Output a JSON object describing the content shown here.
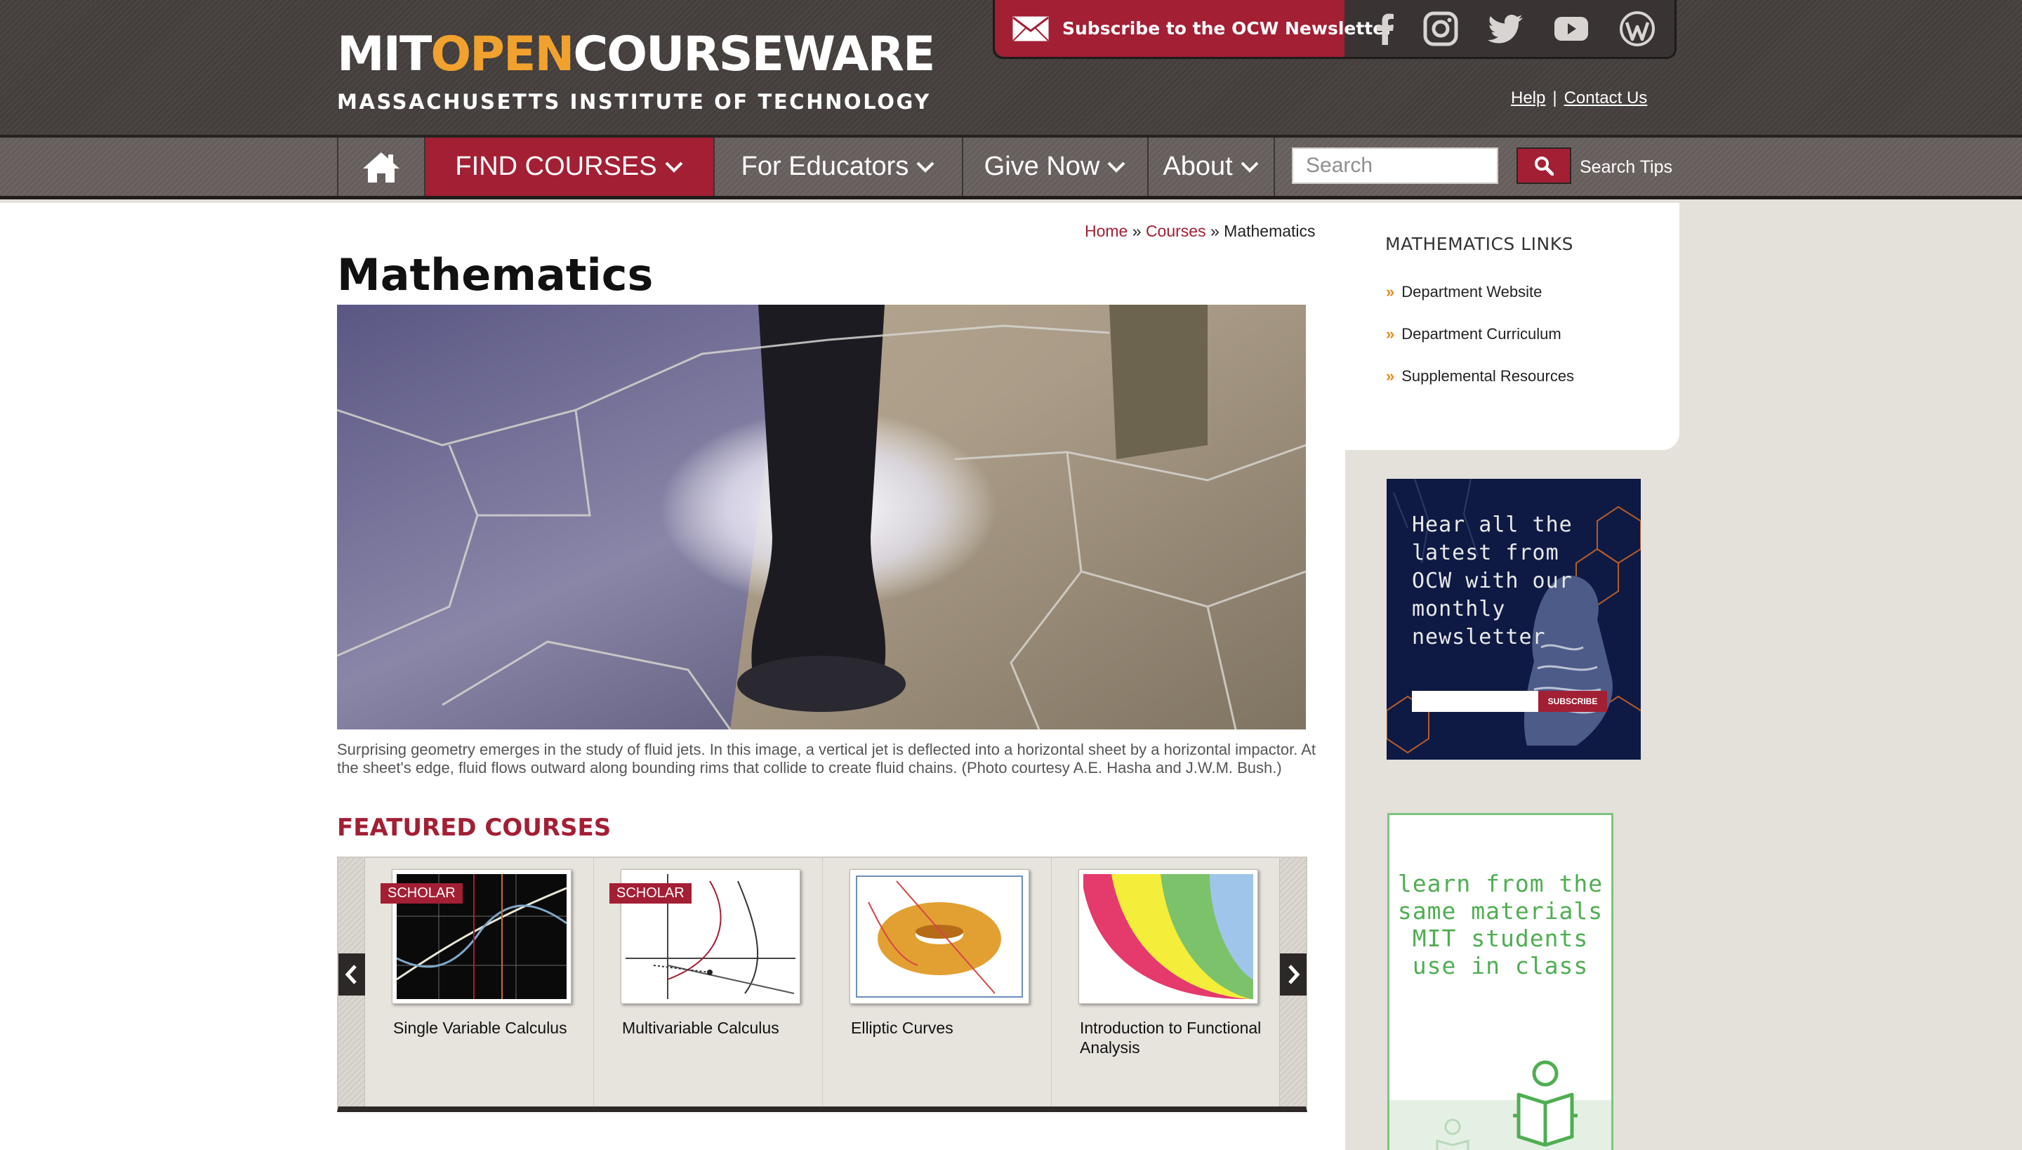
{
  "header": {
    "logo_mit": "MIT",
    "logo_open": "OPEN",
    "logo_courseware": "COURSEWARE",
    "logo_sub": "MASSACHUSETTS INSTITUTE OF TECHNOLOGY",
    "subscribe_label": "Subscribe to the OCW Newsletter",
    "social_icons": [
      "facebook-icon",
      "instagram-icon",
      "twitter-icon",
      "youtube-icon",
      "wordpress-icon"
    ],
    "links": {
      "help": "Help",
      "separator": "|",
      "contact": "Contact Us"
    }
  },
  "nav": {
    "home_icon": "home-icon",
    "items": [
      {
        "label": "FIND COURSES"
      },
      {
        "label": "For Educators"
      },
      {
        "label": "Give Now"
      },
      {
        "label": "About"
      }
    ],
    "search_placeholder": "Search",
    "search_tips": "Search Tips"
  },
  "breadcrumb": {
    "home": "Home",
    "sep1": "»",
    "courses": "Courses",
    "sep2": "»",
    "current": "Mathematics"
  },
  "page": {
    "title": "Mathematics",
    "caption": "Surprising geometry emerges in the study of fluid jets. In this image, a vertical jet is deflected into a horizontal sheet by a horizontal impactor. At the sheet's edge, fluid flows outward along bounding rims that collide to create fluid chains. (Photo courtesy A.E. Hasha and J.W.M. Bush.)",
    "featured_heading": "FEATURED COURSES"
  },
  "courses": [
    {
      "title": "Single Variable Calculus",
      "badge": "SCHOLAR"
    },
    {
      "title": "Multivariable Calculus",
      "badge": "SCHOLAR"
    },
    {
      "title": "Elliptic Curves",
      "badge": ""
    },
    {
      "title": "Introduction to Functional Analysis",
      "badge": ""
    }
  ],
  "sidebar": {
    "links_heading": "MATHEMATICS LINKS",
    "links": [
      "Department Website",
      "Department Curriculum",
      "Supplemental Resources"
    ],
    "raquo": "»",
    "ad_newsletter_text": "Hear all the latest from OCW with our monthly newsletter",
    "ad_subscribe": "SUBSCRIBE",
    "ad_learn_text": "learn from the same materials MIT students use in class"
  },
  "colors": {
    "brand_red": "#a31f34",
    "logo_orange": "#f1a22e",
    "link_bullet": "#e68a1f",
    "ad_green": "#4fae52"
  }
}
